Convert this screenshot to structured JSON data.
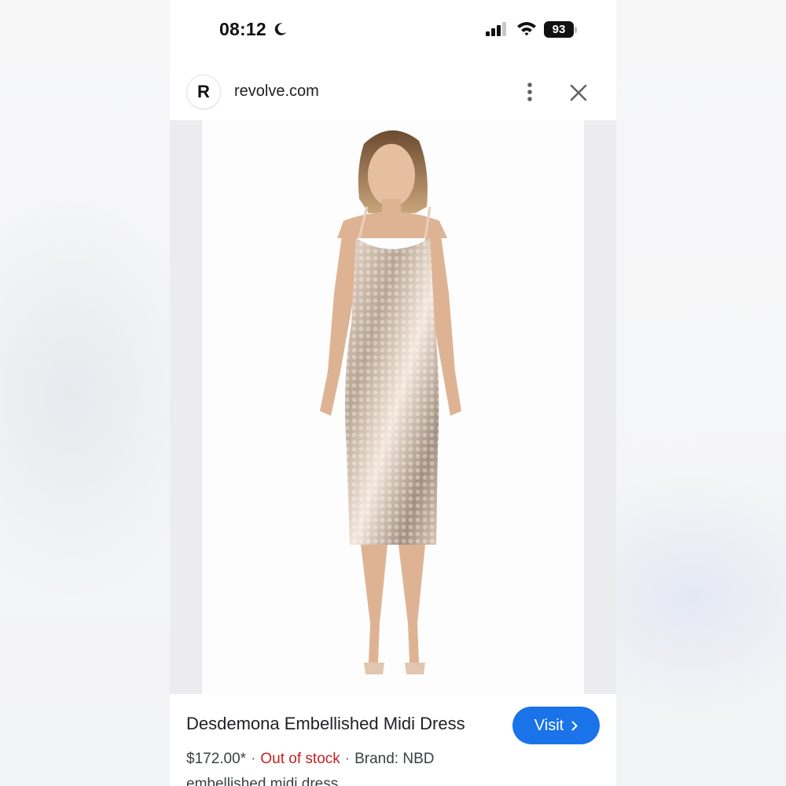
{
  "status_bar": {
    "time": "08:12",
    "battery": "93",
    "icons": [
      "moon-icon",
      "signal-icon",
      "wifi-icon",
      "battery-icon"
    ]
  },
  "header": {
    "logo_letter": "R",
    "domain": "revolve.com",
    "icons": [
      "more-vert-icon",
      "close-icon"
    ]
  },
  "product": {
    "image_alt": "Desdemona Embellished Midi Dress",
    "title": "Desdemona Embellished Midi Dress",
    "price": "$172.00*",
    "separator": "·",
    "stock": "Out of stock",
    "brand": "Brand: NBD",
    "description": "embellished midi dress"
  },
  "actions": {
    "visit_label": "Visit"
  },
  "colors": {
    "accent": "#1a73e8",
    "out_of_stock": "#c5221f",
    "text": "#202124",
    "image_side": "#ececee"
  }
}
